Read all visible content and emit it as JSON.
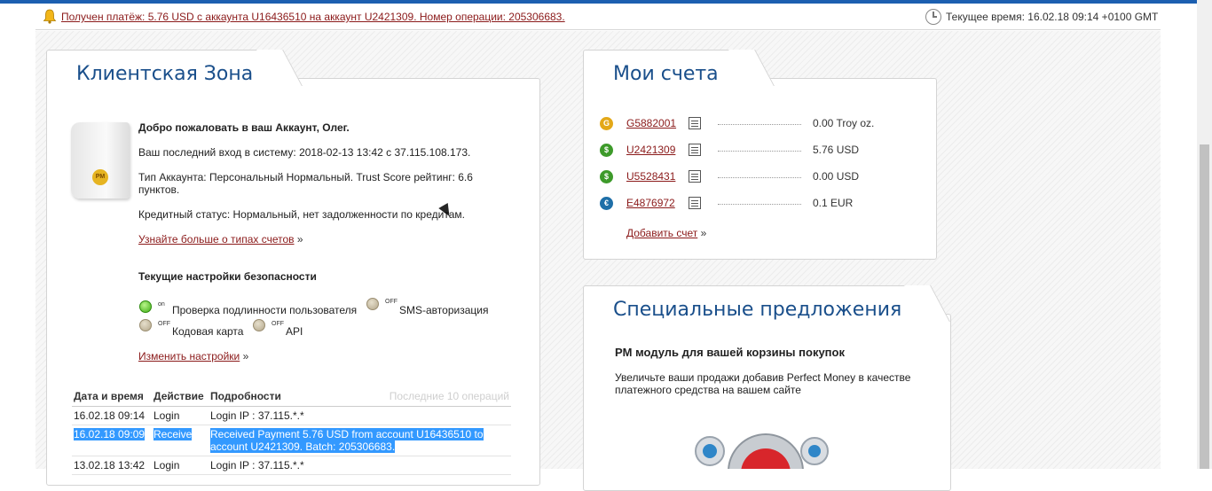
{
  "notice": {
    "payment_text": "Получен платёж: 5.76 USD с аккаунта U16436510 на аккаунт U2421309. Номер операции: 205306683.",
    "time_text": "Текущее время: 16.02.18 09:14 +0100 GMT"
  },
  "client_zone": {
    "title": "Клиентская Зона",
    "badge": "PM",
    "welcome": "Добро пожаловать в ваш Аккаунт, Олег.",
    "last_login": "Ваш последний вход в систему: 2018-02-13 13:42 с 37.115.108.173.",
    "account_type": "Тип Аккаунта: Персональный Нормальный. Trust Score рейтинг: 6.6 пунктов.",
    "credit_status": "Кредитный статус: Нормальный, нет задолженности по кредитам.",
    "learn_more_link": "Узнайте больше о типах счетов",
    "raquo": "»",
    "security_heading": "Текущие настройки безопасности",
    "security": [
      {
        "label": "Проверка подлинности пользователя",
        "state": "on"
      },
      {
        "label": "SMS-авторизация",
        "state": "OFF"
      },
      {
        "label": "Кодовая карта",
        "state": "OFF"
      },
      {
        "label": "API",
        "state": "OFF"
      }
    ],
    "change_settings_link": "Изменить настройки",
    "table": {
      "headers": [
        "Дата и время",
        "Действие",
        "Подробности"
      ],
      "last_ops_label": "Последние 10 операций",
      "rows": [
        {
          "date": "16.02.18 09:14",
          "action": "Login",
          "details": "Login IP : 37.115.*.*"
        },
        {
          "date": "16.02.18 09:09",
          "action": "Receive",
          "details": "Received Payment 5.76 USD from account U16436510 to account U2421309. Batch: 205306683."
        },
        {
          "date": "13.02.18 13:42",
          "action": "Login",
          "details": "Login IP : 37.115.*.*"
        }
      ]
    }
  },
  "accounts": {
    "title": "Мои счета",
    "items": [
      {
        "id": "G5882001",
        "balance": "0.00 Troy oz.",
        "coin": "G",
        "color": "#e3a818",
        "icon": "gold-coin-icon"
      },
      {
        "id": "U2421309",
        "balance": "5.76 USD",
        "coin": "$",
        "color": "#3d9a2a",
        "icon": "usd-coin-icon"
      },
      {
        "id": "U5528431",
        "balance": "0.00 USD",
        "coin": "$",
        "color": "#3d9a2a",
        "icon": "usd-coin-icon"
      },
      {
        "id": "E4876972",
        "balance": "0.1 EUR",
        "coin": "€",
        "color": "#1e6fa8",
        "icon": "eur-coin-icon"
      }
    ],
    "add_account_link": "Добавить счет"
  },
  "offers": {
    "title": "Специальные предложения",
    "heading": "PM модуль для вашей корзины покупок",
    "text": "Увеличьте ваши продажи добавив Perfect Money в качестве платежного средства на вашем сайте"
  }
}
